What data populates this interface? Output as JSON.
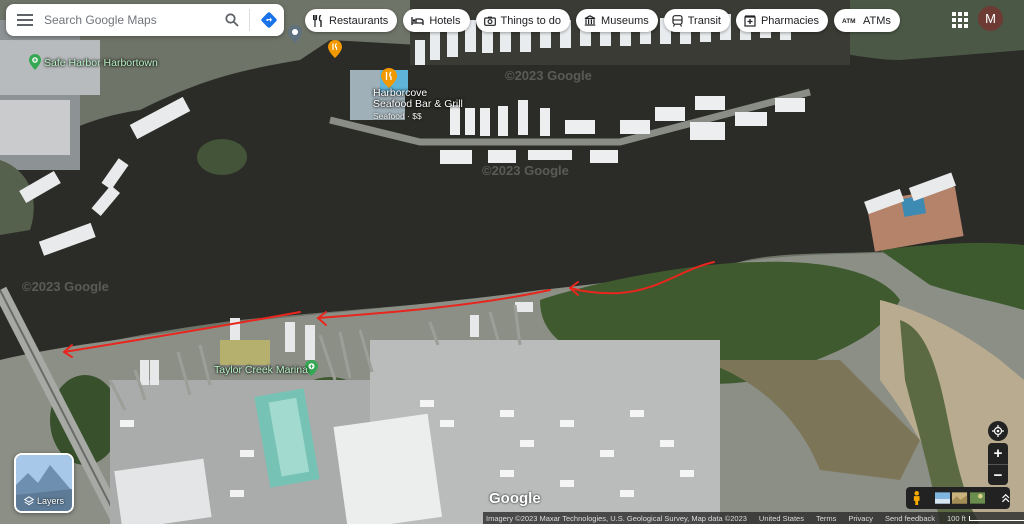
{
  "search": {
    "placeholder": "Search Google Maps"
  },
  "chips": [
    {
      "label": "Restaurants",
      "icon": "fork-knife-icon"
    },
    {
      "label": "Hotels",
      "icon": "bed-icon"
    },
    {
      "label": "Things to do",
      "icon": "camera-icon"
    },
    {
      "label": "Museums",
      "icon": "museum-icon"
    },
    {
      "label": "Transit",
      "icon": "train-icon"
    },
    {
      "label": "Pharmacies",
      "icon": "pharmacy-icon"
    },
    {
      "label": "ATMs",
      "icon": "atm-icon"
    }
  ],
  "account": {
    "initial": "M"
  },
  "places": {
    "safe_harbor": "Safe Harbor Harbortown",
    "restaurant_name_line1": "Harborcove",
    "restaurant_name_line2": "Seafood Bar & Grill",
    "restaurant_category": "Seafood · $$",
    "taylor_creek": "Taylor Creek Marina"
  },
  "watermark": "©2023 Google",
  "layers": {
    "label": "Layers"
  },
  "zoom": {
    "in": "+",
    "out": "−"
  },
  "google_logo": "Google",
  "bottom": {
    "imagery": "Imagery ©2023 Maxar Technologies, U.S. Geological Survey, Map data ©2023",
    "country": "United States",
    "terms": "Terms",
    "privacy": "Privacy",
    "feedback": "Send feedback",
    "scale": "100 ft"
  },
  "colors": {
    "water": "#2b2c27",
    "marker_green": "#34a853",
    "marker_orange": "#f29900",
    "annotation_red": "#e8261d"
  }
}
